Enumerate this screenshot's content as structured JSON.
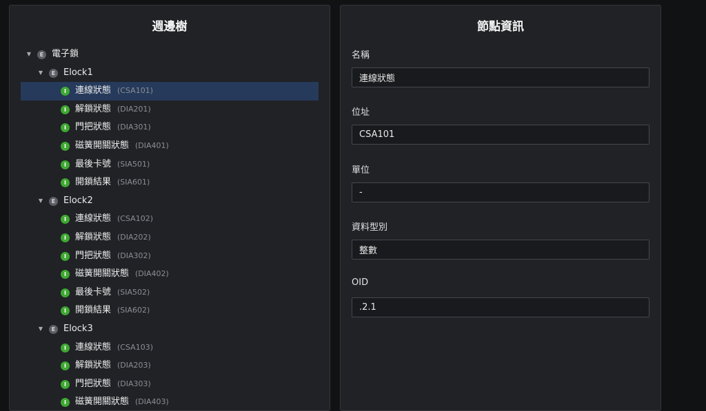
{
  "tree_panel": {
    "title": "週邊樹",
    "nodes": [
      {
        "label": "電子鎖",
        "code": "",
        "type": "E",
        "level": 0,
        "selected": false
      },
      {
        "label": "Elock1",
        "code": "",
        "type": "E",
        "level": 1,
        "selected": false
      },
      {
        "label": "連線狀態",
        "code": "(CSA101)",
        "type": "I",
        "level": 2,
        "selected": true
      },
      {
        "label": "解鎖狀態",
        "code": "(DIA201)",
        "type": "I",
        "level": 2,
        "selected": false
      },
      {
        "label": "門把狀態",
        "code": "(DIA301)",
        "type": "I",
        "level": 2,
        "selected": false
      },
      {
        "label": "磁簧開關狀態",
        "code": "(DIA401)",
        "type": "I",
        "level": 2,
        "selected": false
      },
      {
        "label": "最後卡號",
        "code": "(SIA501)",
        "type": "I",
        "level": 2,
        "selected": false
      },
      {
        "label": "開鎖結果",
        "code": "(SIA601)",
        "type": "I",
        "level": 2,
        "selected": false
      },
      {
        "label": "Elock2",
        "code": "",
        "type": "E",
        "level": 1,
        "selected": false
      },
      {
        "label": "連線狀態",
        "code": "(CSA102)",
        "type": "I",
        "level": 2,
        "selected": false
      },
      {
        "label": "解鎖狀態",
        "code": "(DIA202)",
        "type": "I",
        "level": 2,
        "selected": false
      },
      {
        "label": "門把狀態",
        "code": "(DIA302)",
        "type": "I",
        "level": 2,
        "selected": false
      },
      {
        "label": "磁簧開關狀態",
        "code": "(DIA402)",
        "type": "I",
        "level": 2,
        "selected": false
      },
      {
        "label": "最後卡號",
        "code": "(SIA502)",
        "type": "I",
        "level": 2,
        "selected": false
      },
      {
        "label": "開鎖結果",
        "code": "(SIA602)",
        "type": "I",
        "level": 2,
        "selected": false
      },
      {
        "label": "Elock3",
        "code": "",
        "type": "E",
        "level": 1,
        "selected": false
      },
      {
        "label": "連線狀態",
        "code": "(CSA103)",
        "type": "I",
        "level": 2,
        "selected": false
      },
      {
        "label": "解鎖狀態",
        "code": "(DIA203)",
        "type": "I",
        "level": 2,
        "selected": false
      },
      {
        "label": "門把狀態",
        "code": "(DIA303)",
        "type": "I",
        "level": 2,
        "selected": false
      },
      {
        "label": "磁簧開關狀態",
        "code": "(DIA403)",
        "type": "I",
        "level": 2,
        "selected": false
      }
    ]
  },
  "info_panel": {
    "title": "節點資訊",
    "fields": [
      {
        "label": "名稱",
        "value": "連線狀態"
      },
      {
        "label": "位址",
        "value": "CSA101"
      },
      {
        "label": "單位",
        "value": "-"
      },
      {
        "label": "資料型別",
        "value": "整數"
      },
      {
        "label": "OID",
        "value": ".2.1"
      }
    ]
  },
  "colors": {
    "selected_row": "#263a5b",
    "item_badge": "#3fa832",
    "entity_badge": "#5c5f66"
  }
}
